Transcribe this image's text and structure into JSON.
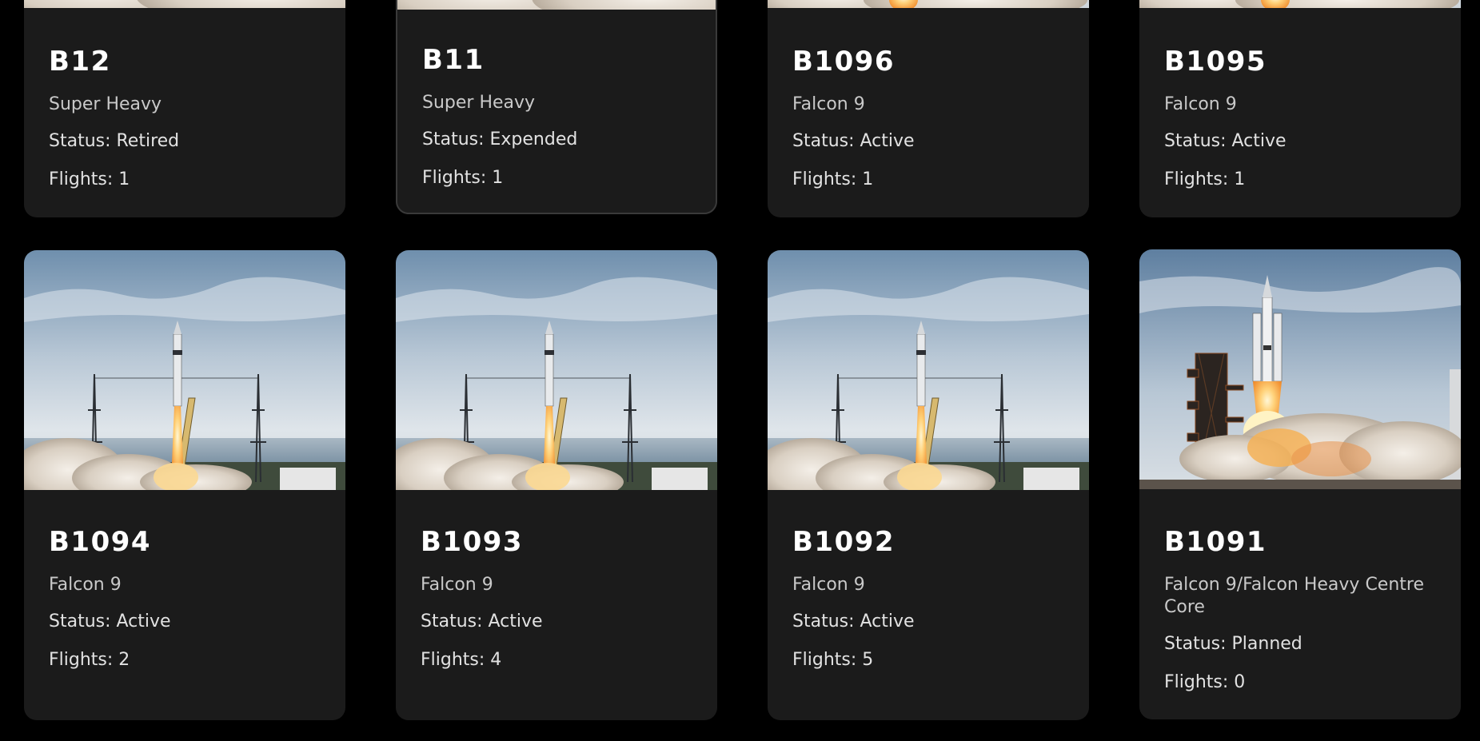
{
  "boosters": [
    {
      "serial": "B12",
      "vehicle": "Super Heavy",
      "status": "Status: Retired",
      "flights": "Flights: 1",
      "image": "launch-photo"
    },
    {
      "serial": "B11",
      "vehicle": "Super Heavy",
      "status": "Status: Expended",
      "flights": "Flights: 1",
      "image": "launch-photo"
    },
    {
      "serial": "B1096",
      "vehicle": "Falcon 9",
      "status": "Status: Active",
      "flights": "Flights: 1",
      "image": "falcon9-launch-photo"
    },
    {
      "serial": "B1095",
      "vehicle": "Falcon 9",
      "status": "Status: Active",
      "flights": "Flights: 1",
      "image": "falcon9-launch-photo"
    },
    {
      "serial": "B1094",
      "vehicle": "Falcon 9",
      "status": "Status: Active",
      "flights": "Flights: 2",
      "image": "falcon9-launch-photo"
    },
    {
      "serial": "B1093",
      "vehicle": "Falcon 9",
      "status": "Status: Active",
      "flights": "Flights: 4",
      "image": "falcon9-launch-photo"
    },
    {
      "serial": "B1092",
      "vehicle": "Falcon 9",
      "status": "Status: Active",
      "flights": "Flights: 5",
      "image": "falcon9-launch-photo"
    },
    {
      "serial": "B1091",
      "vehicle": "Falcon 9/Falcon Heavy Centre Core",
      "status": "Status: Planned",
      "flights": "Flights: 0",
      "image": "falcon-heavy-launch-photo"
    }
  ],
  "colors": {
    "page_background": "#000000",
    "card_background": "#1b1b1b",
    "title": "#ffffff",
    "subtitle": "#c9c9c9",
    "meta": "#e2e2e2"
  }
}
